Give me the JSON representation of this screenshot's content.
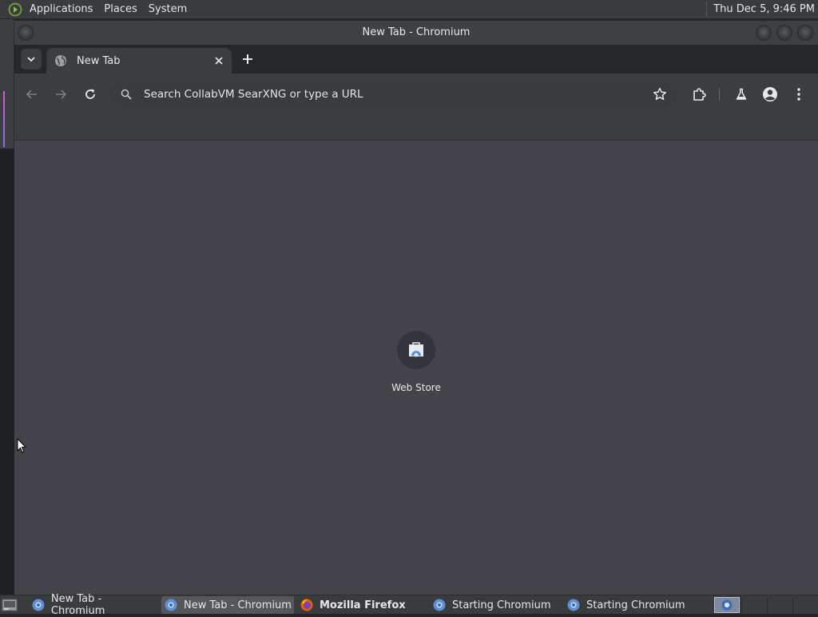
{
  "top_panel": {
    "menus": [
      "Applications",
      "Places",
      "System"
    ],
    "clock": "Thu Dec  5,  9:46 PM"
  },
  "window": {
    "title": "New Tab - Chromium"
  },
  "tabs": [
    {
      "title": "New Tab",
      "active": true
    }
  ],
  "toolbar": {
    "omnibox_placeholder": "Search CollabVM SearXNG or type a URL"
  },
  "content": {
    "shortcuts": [
      {
        "label": "Web Store",
        "icon": "web-store-icon"
      }
    ]
  },
  "taskbar": {
    "tasks": [
      {
        "label": "New Tab - Chromium",
        "icon": "chromium-icon",
        "active": false,
        "bold": false
      },
      {
        "label": "New Tab - Chromium",
        "icon": "chromium-icon",
        "active": true,
        "bold": false
      },
      {
        "label": "Mozilla Firefox",
        "icon": "firefox-icon",
        "active": false,
        "bold": true
      },
      {
        "label": "Starting Chromium",
        "icon": "chromium-icon",
        "active": false,
        "bold": false
      },
      {
        "label": "Starting Chromium",
        "icon": "chromium-icon",
        "active": false,
        "bold": false
      }
    ]
  },
  "colors": {
    "panel_bg": "#3a3b3d",
    "tabstrip_bg": "#26272a",
    "toolbar_bg": "#3c3d41",
    "content_bg": "#434349",
    "text": "#e8e8e8"
  }
}
